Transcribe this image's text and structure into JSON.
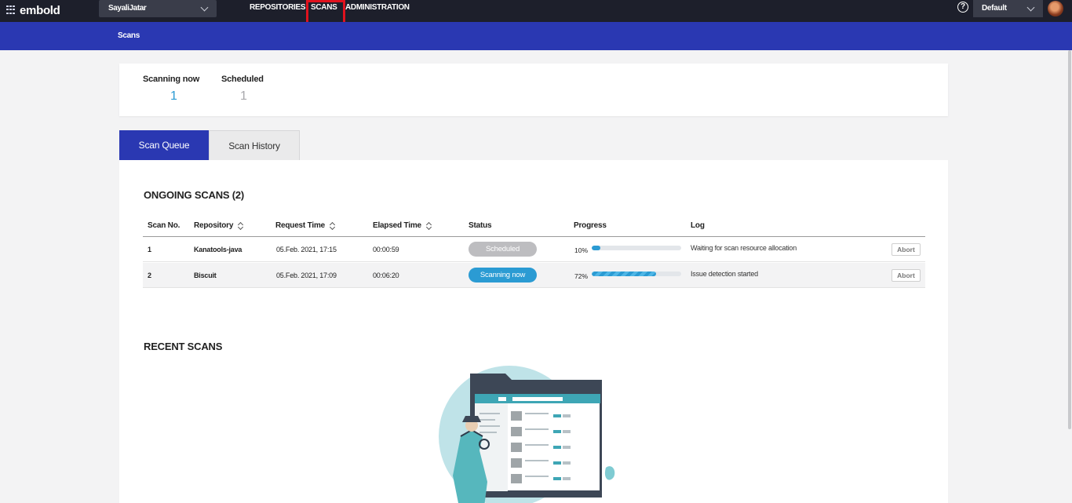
{
  "topbar": {
    "logo_text": "embold",
    "org_select": "SayaliJatar",
    "nav": [
      "REPOSITORIES",
      "SCANS",
      "ADMINISTRATION"
    ],
    "help_symbol": "?",
    "view_select": "Default",
    "icons": {
      "help": "help-circle-icon",
      "dropdown": "chevron-down-icon",
      "avatar": "user-avatar"
    }
  },
  "subheader": {
    "title": "Scans"
  },
  "summary": {
    "scanning_now_label": "Scanning now",
    "scanning_now_value": "1",
    "scheduled_label": "Scheduled",
    "scheduled_value": "1"
  },
  "tabs": [
    "Scan Queue",
    "Scan History"
  ],
  "ongoing": {
    "title": "ONGOING SCANS (2)",
    "columns": [
      "Scan No.",
      "Repository",
      "Request Time",
      "Elapsed Time",
      "Status",
      "Progress",
      "Log"
    ],
    "rows": [
      {
        "no": "1",
        "repository": "Kanatools-java",
        "request_time": "05.Feb. 2021, 17:15",
        "elapsed": "00:00:59",
        "status": "Scheduled",
        "progress_label": "10%",
        "progress": 10,
        "log": "Waiting for scan resource allocation",
        "action": "Abort"
      },
      {
        "no": "2",
        "repository": "Biscuit",
        "request_time": "05.Feb. 2021, 17:09",
        "elapsed": "00:06:20",
        "status": "Scanning now",
        "progress_label": "72%",
        "progress": 72,
        "log": "Issue detection started",
        "action": "Abort"
      }
    ]
  },
  "recent": {
    "title": "RECENT SCANS"
  },
  "colors": {
    "topbar": "#1d1f2b",
    "brand_blue": "#2a38b2",
    "accent": "#2b9bd3",
    "scheduled_gray": "#bdbdc0",
    "highlight_red": "#e0121e"
  }
}
